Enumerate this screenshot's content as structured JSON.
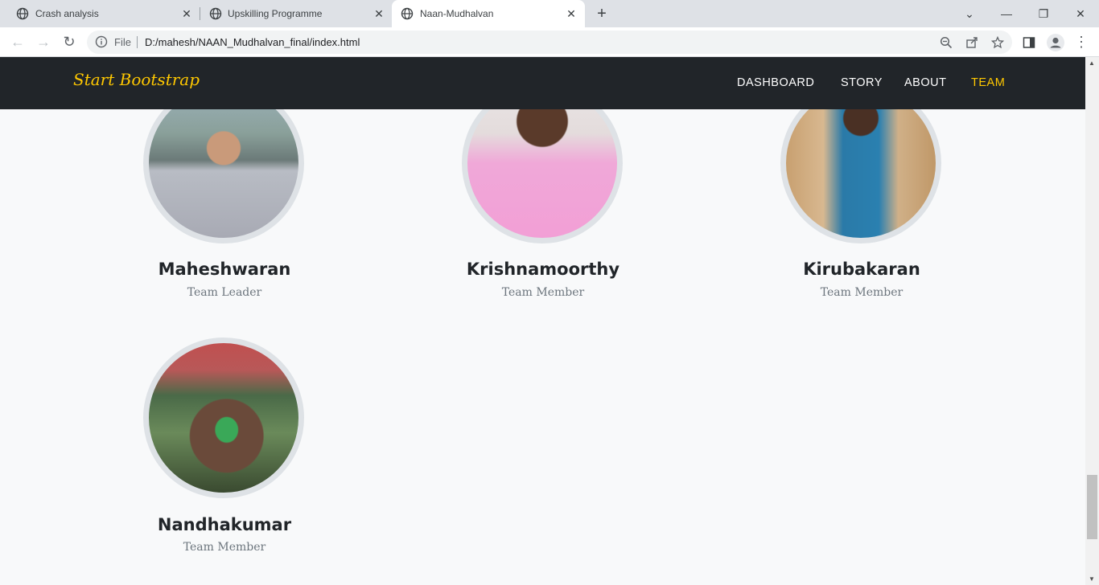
{
  "browser": {
    "tabs": [
      {
        "title": "Crash analysis"
      },
      {
        "title": "Upskilling Programme"
      },
      {
        "title": "Naan-Mudhalvan"
      }
    ],
    "address": {
      "scheme_label": "File",
      "url": "D:/mahesh/NAAN_Mudhalvan_final/index.html"
    }
  },
  "navbar": {
    "brand": "Start Bootstrap",
    "links": [
      {
        "label": "DASHBOARD"
      },
      {
        "label": "STORY"
      },
      {
        "label": "ABOUT"
      },
      {
        "label": "TEAM",
        "active": true
      }
    ],
    "colors": {
      "background": "#212529",
      "accent": "#ffc800"
    }
  },
  "team": [
    {
      "name": "Maheshwaran",
      "role": "Team Leader"
    },
    {
      "name": "Krishnamoorthy",
      "role": "Team Member"
    },
    {
      "name": "Kirubakaran",
      "role": "Team Member"
    },
    {
      "name": "Nandhakumar",
      "role": "Team Member"
    }
  ]
}
